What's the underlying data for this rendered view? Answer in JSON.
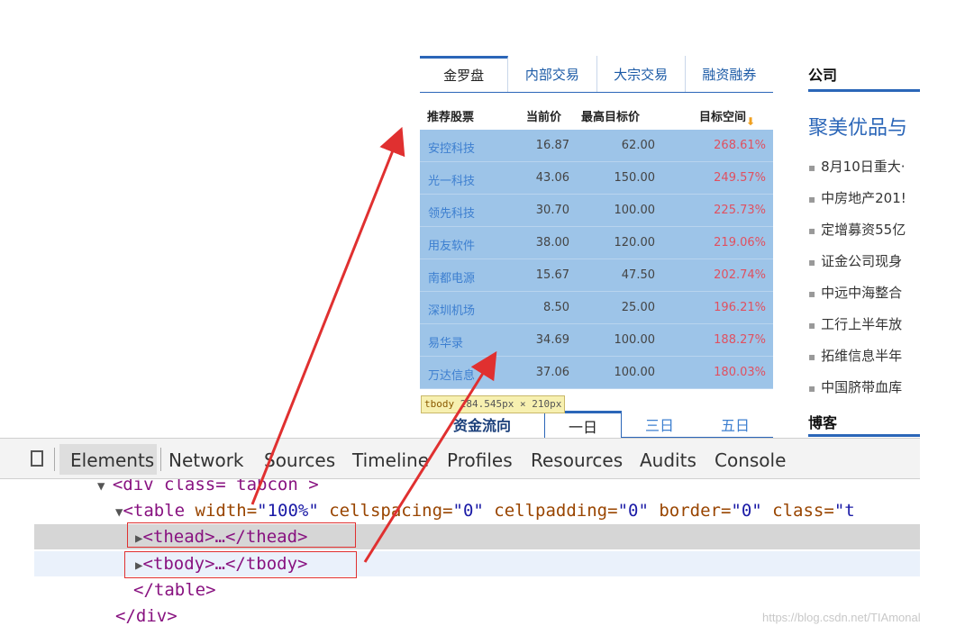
{
  "widget": {
    "tabs": [
      "金罗盘",
      "内部交易",
      "大宗交易",
      "融资融券"
    ],
    "headers": {
      "name": "推荐股票",
      "price": "当前价",
      "target": "最高目标价",
      "space": "目标空间",
      "sort_icon": "down-arrow-icon"
    },
    "rows": [
      {
        "name": "安控科技",
        "price": "16.87",
        "target": "62.00",
        "space": "268.61%"
      },
      {
        "name": "光一科技",
        "price": "43.06",
        "target": "150.00",
        "space": "249.57%"
      },
      {
        "name": "领先科技",
        "price": "30.70",
        "target": "100.00",
        "space": "225.73%"
      },
      {
        "name": "用友软件",
        "price": "38.00",
        "target": "120.00",
        "space": "219.06%"
      },
      {
        "name": "南都电源",
        "price": "15.67",
        "target": "47.50",
        "space": "202.74%"
      },
      {
        "name": "深圳机场",
        "price": "8.50",
        "target": "25.00",
        "space": "196.21%"
      },
      {
        "name": "易华录",
        "price": "34.69",
        "target": "100.00",
        "space": "188.27%"
      },
      {
        "name": "万达信息",
        "price": "37.06",
        "target": "100.00",
        "space": "180.03%"
      }
    ],
    "tooltip": {
      "tag": "tbody",
      "size": "284.545px × 210px"
    },
    "fund_tabs": [
      "资金流向",
      "一日",
      "三日",
      "五日"
    ]
  },
  "news": {
    "heading": "公司",
    "headline": "聚美优品与",
    "items": [
      "8月10日重大·",
      "中房地产201!",
      "定增募资55亿",
      "证金公司现身",
      "中远中海整合",
      "工行上半年放",
      "拓维信息半年",
      "中国脐带血库"
    ],
    "blog_heading": "博客"
  },
  "devtools": {
    "tabs": [
      "Elements",
      "Network",
      "Sources",
      "Timeline",
      "Profiles",
      "Resources",
      "Audits",
      "Console"
    ],
    "code": {
      "line0": "<div class= tabcon >",
      "table_open": "<table",
      "attr1": " width=",
      "val1": "\"100%\"",
      "attr2": " cellspacing=",
      "val2": "\"0\"",
      "attr3": " cellpadding=",
      "val3": "\"0\"",
      "attr4": " border=",
      "val4": "\"0\"",
      "attr5": " class=",
      "val5": "\"t",
      "thead": "<thead>…</thead>",
      "tbody": "<tbody>…</tbody>",
      "table_close": "</table>",
      "div_close": "</div>"
    }
  },
  "colors": {
    "accent": "#2b66b8",
    "tbody_highlight": "#9dc4e8",
    "annotation_red": "#e03030"
  },
  "watermark": "https://blog.csdn.net/TIAmonal"
}
